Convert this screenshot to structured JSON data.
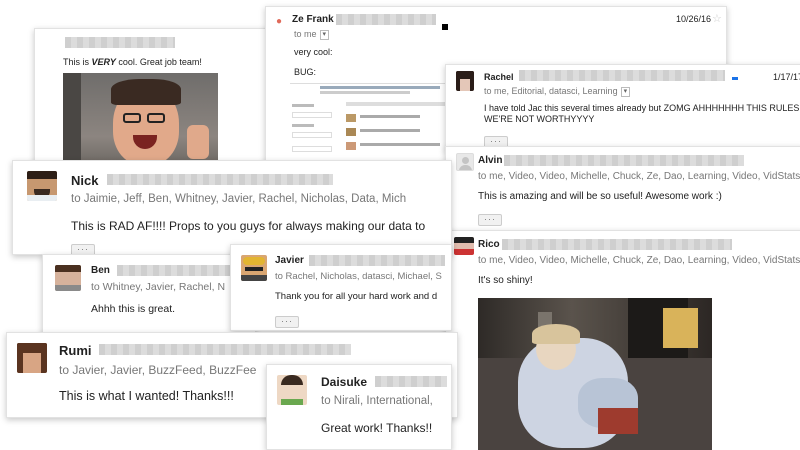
{
  "top_left": {
    "message": "This is VERY cool. Great job team!",
    "emphasis": "VERY"
  },
  "zefrank": {
    "name": "Ze Frank",
    "date": "10/26/16",
    "to": "to me",
    "line1": "very cool:",
    "line2": "BUG:"
  },
  "rachel": {
    "name": "Rachel",
    "date": "1/17/17",
    "to": "to me, Editorial, datasci, Learning",
    "message_line1": "I have told Jac this several times already but ZOMG AHHHHHHH THIS RULES",
    "message_line2": "WE'RE NOT WORTHYYYY"
  },
  "alvin": {
    "name": "Alvin",
    "to": "to me, Video, Video, Michelle, Chuck, Ze, Dao, Learning, Video, VidStats",
    "message": "This is amazing and will be so useful! Awesome work :)"
  },
  "rico": {
    "name": "Rico",
    "to": "to me, Video, Video, Michelle, Chuck, Ze, Dao, Learning, Video, VidStats",
    "message": "It's so shiny!"
  },
  "nick": {
    "name": "Nick",
    "to": "to Jaimie, Jeff, Ben, Whitney, Javier, Rachel, Nicholas, Data, Mich",
    "message": "This is RAD AF!!!! Props to you guys for always making our data to"
  },
  "ben": {
    "name": "Ben",
    "to": "to Whitney, Javier, Rachel, N",
    "message": "Ahhh this is great."
  },
  "javier": {
    "name": "Javier",
    "to": "to Rachel, Nicholas, datasci, Michael, S",
    "message": "Thank you for all your hard work and d"
  },
  "rumi": {
    "name": "Rumi",
    "to": "to Javier, Javier, BuzzFeed, BuzzFee",
    "message": "This is what I wanted! Thanks!!!"
  },
  "daisuke": {
    "name": "Daisuke",
    "to": "to Nirali, International,",
    "message": "Great work! Thanks!!"
  },
  "colors": {
    "accent_blue": "#1a73e8",
    "text": "#222222",
    "muted": "#777777"
  }
}
